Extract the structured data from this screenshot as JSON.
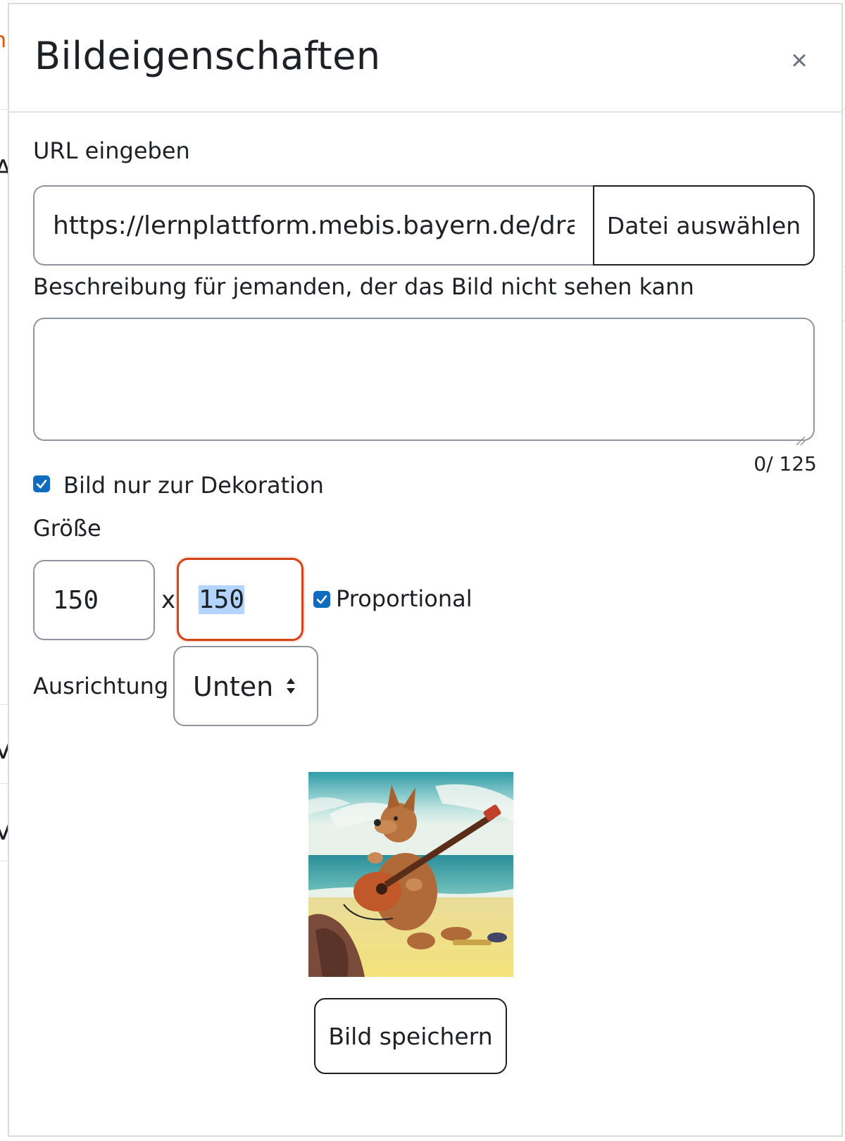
{
  "dialog": {
    "title": "Bildeigenschaften",
    "close_symbol": "×"
  },
  "url": {
    "label": "URL eingeben",
    "value": "https://lernplattform.mebis.bayern.de/draft",
    "file_button": "Datei auswählen"
  },
  "description": {
    "label": "Beschreibung für jemanden, der das Bild nicht sehen kann",
    "value": "",
    "counter": "0/ 125"
  },
  "decorative": {
    "label": "Bild nur zur Dekoration",
    "checked": true
  },
  "size": {
    "label": "Größe",
    "width": "150",
    "separator": "x",
    "height": "150",
    "proportional_label": "Proportional",
    "proportional_checked": true
  },
  "alignment": {
    "label": "Ausrichtung",
    "selected": "Unten"
  },
  "preview": {
    "icon": "image-preview"
  },
  "actions": {
    "save_label": "Bild speichern"
  },
  "colors": {
    "accent": "#0f6cbf",
    "focus": "#d84315",
    "border": "#8f959e",
    "text": "#1d2125"
  }
}
